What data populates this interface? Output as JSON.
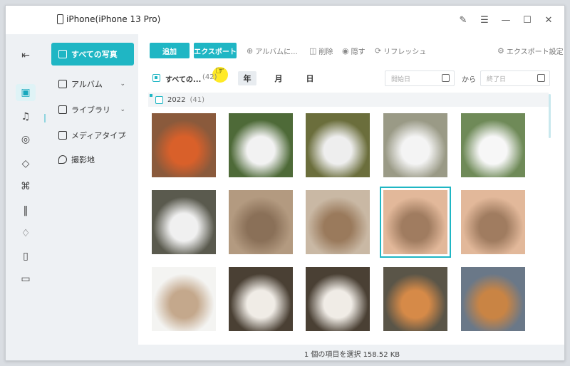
{
  "window": {
    "device_title": "iPhone(iPhone 13 Pro)"
  },
  "rail": {
    "icons": [
      "exit-icon",
      "photo-icon",
      "music-icon",
      "video-icon",
      "contacts-icon",
      "apps-icon",
      "books-icon",
      "tag-icon",
      "device-icon",
      "folder-icon"
    ]
  },
  "nav": {
    "items": [
      {
        "label": "すべての写真",
        "icon": "photo-icon"
      },
      {
        "label": "アルバム",
        "icon": "album-icon"
      },
      {
        "label": "ライブラリ",
        "icon": "library-icon"
      },
      {
        "label": "メディアタイプ",
        "icon": "media-icon"
      },
      {
        "label": "撮影地",
        "icon": "location-icon"
      }
    ]
  },
  "toolbar": {
    "add_label": "追加",
    "export_label": "エクスポート",
    "album_label": "アルバムに...",
    "delete_label": "削除",
    "hide_label": "隠す",
    "refresh_label": "リフレッシュ",
    "export_settings_label": "エクスポート設定"
  },
  "filter": {
    "all_label": "すべての...",
    "all_count": "(42)",
    "year_label": "年",
    "month_label": "月",
    "day_label": "日",
    "start_placeholder": "開始日",
    "from_label": "から",
    "end_placeholder": "終了日"
  },
  "group": {
    "year": "2022",
    "count": "(41)"
  },
  "photos": [
    {
      "subject": "red-panda",
      "bg": "#8a5a3c",
      "fg": "#d9602a"
    },
    {
      "subject": "panda-branch",
      "bg": "#4e6a38",
      "fg": "#f2f2f2"
    },
    {
      "subject": "panda-tree",
      "bg": "#6b6e3c",
      "fg": "#eeeeee"
    },
    {
      "subject": "panda-sitting",
      "bg": "#9a9a86",
      "fg": "#f4f4f4"
    },
    {
      "subject": "panda-face",
      "bg": "#6f8a58",
      "fg": "#f7f7f7"
    },
    {
      "subject": "panda-climbing",
      "bg": "#5a5a4e",
      "fg": "#f0f0f0"
    },
    {
      "subject": "kitten-paws",
      "bg": "#b39a80",
      "fg": "#8a7058"
    },
    {
      "subject": "bird",
      "bg": "#c9b8a4",
      "fg": "#9a7a5c"
    },
    {
      "subject": "hedgehog-hand",
      "bg": "#e2b89a",
      "fg": "#a07c60"
    },
    {
      "subject": "hedgehog-hand-2",
      "bg": "#e2b89a",
      "fg": "#a07c60"
    },
    {
      "subject": "hedgehog-white",
      "bg": "#f4f4f2",
      "fg": "#c4a88c"
    },
    {
      "subject": "kitten-playing",
      "bg": "#4a4034",
      "fg": "#f0ece6"
    },
    {
      "subject": "kitten-playing-2",
      "bg": "#4a4034",
      "fg": "#f0ece6"
    },
    {
      "subject": "shiba-inu",
      "bg": "#5a5548",
      "fg": "#d68a48"
    },
    {
      "subject": "shiba-inu-2",
      "bg": "#6a7888",
      "fg": "#c98444"
    }
  ],
  "selected_index": 8,
  "status": {
    "text": "1 個の項目を選択 158.52 KB"
  }
}
